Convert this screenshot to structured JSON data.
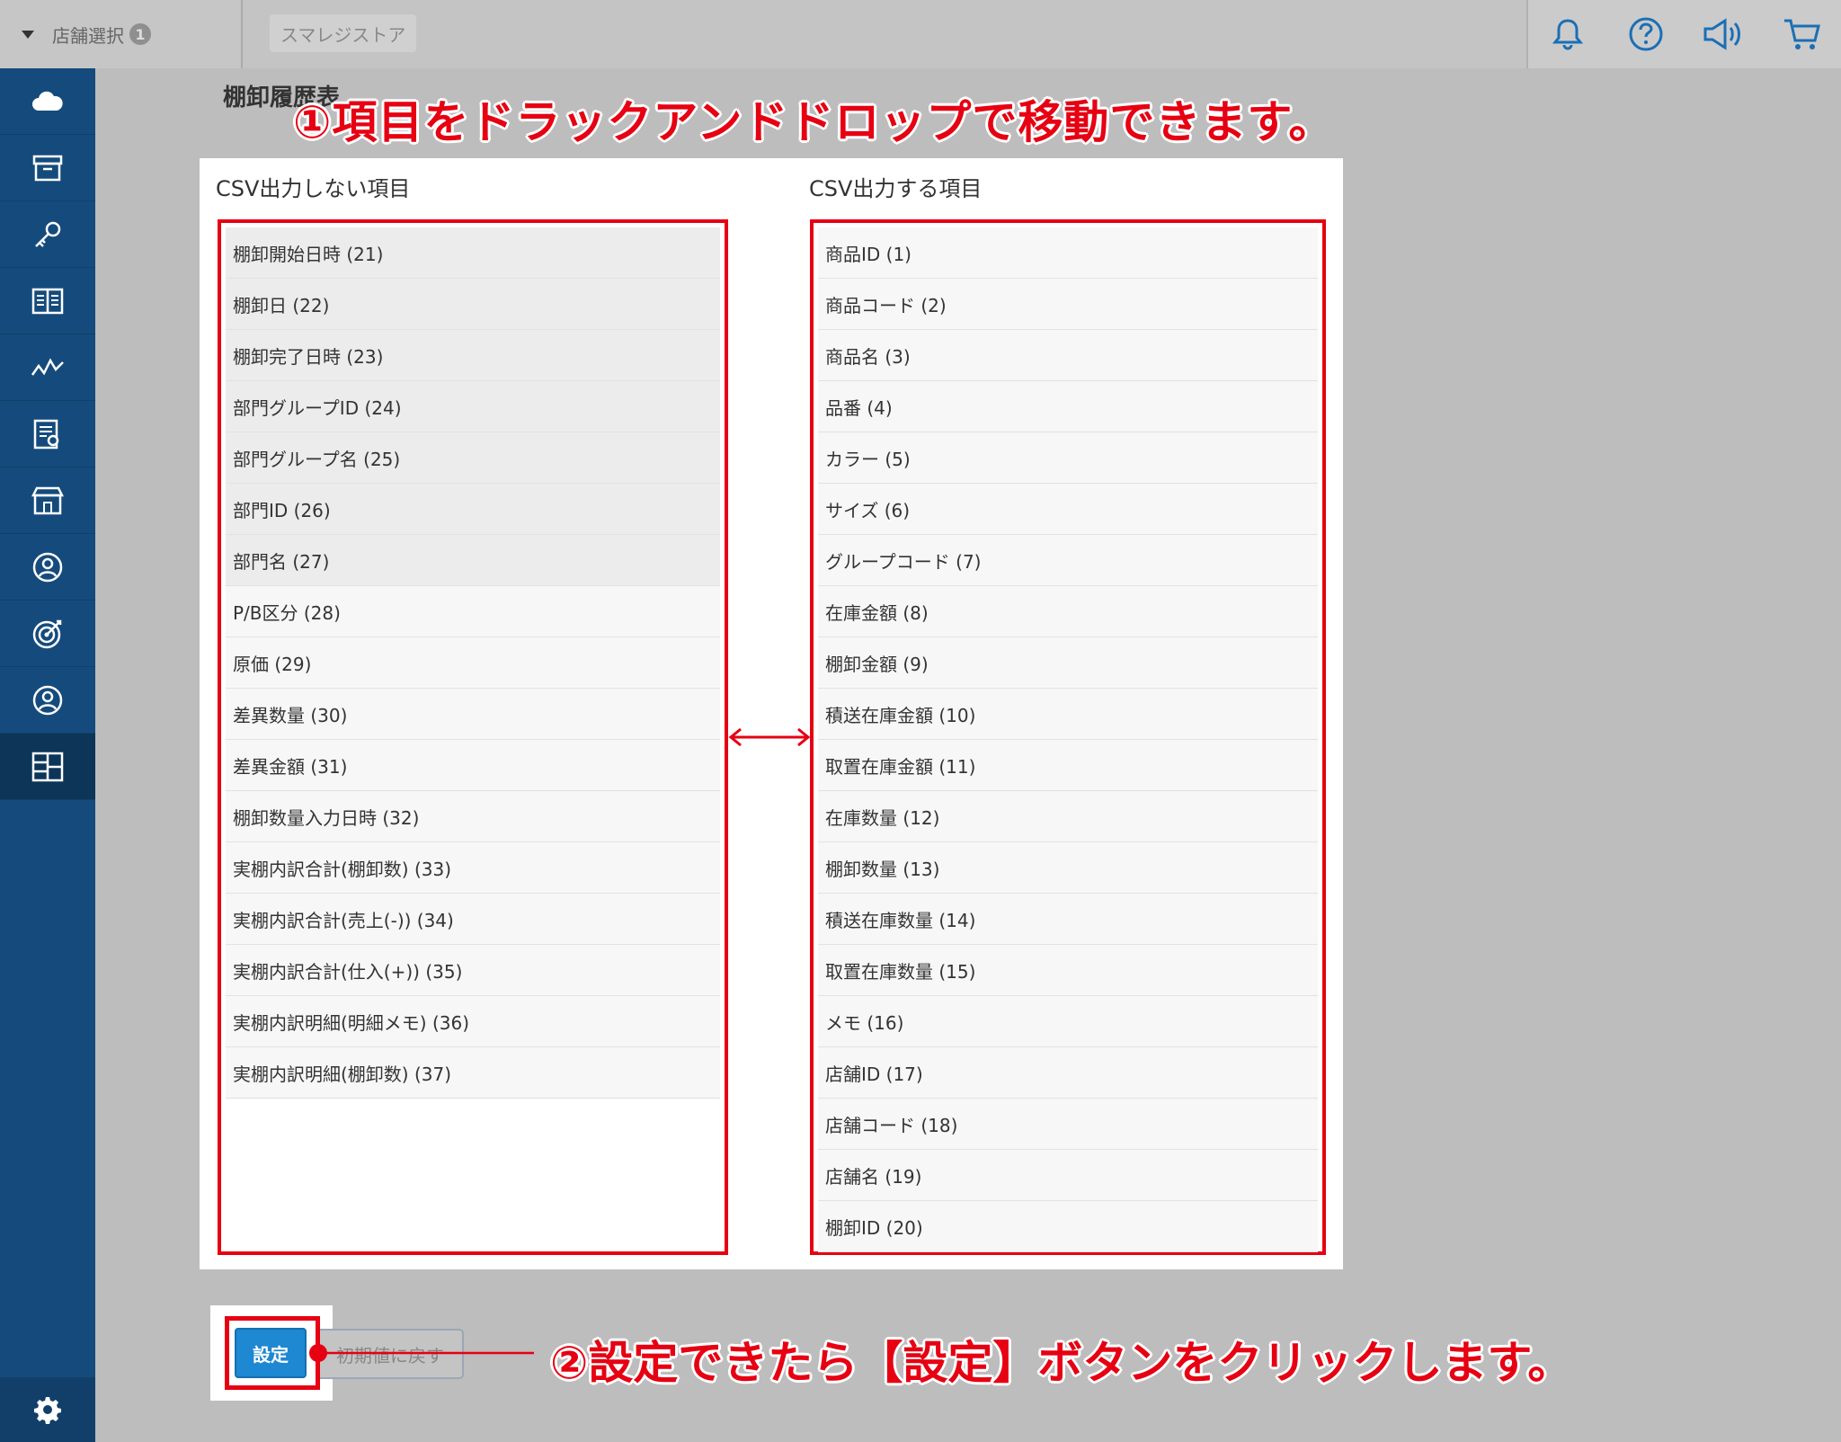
{
  "topbar": {
    "store_select_label": "店舗選択",
    "store_select_badge": "1",
    "store_name": "スマレジストア"
  },
  "page": {
    "title": "棚卸履歴表"
  },
  "annotations": {
    "step1": "①項目をドラックアンドドロップで移動できます。",
    "step2": "②設定できたら【設定】ボタンをクリックします。"
  },
  "columns": {
    "left_heading": "CSV出力しない項目",
    "right_heading": "CSV出力する項目"
  },
  "left_items": [
    "棚卸開始日時 (21)",
    "棚卸日 (22)",
    "棚卸完了日時 (23)",
    "部門グループID (24)",
    "部門グループ名 (25)",
    "部門ID (26)",
    "部門名 (27)",
    "P/B区分 (28)",
    "原価 (29)",
    "差異数量 (30)",
    "差異金額 (31)",
    "棚卸数量入力日時 (32)",
    "実棚内訳合計(棚卸数) (33)",
    "実棚内訳合計(売上(-)) (34)",
    "実棚内訳合計(仕入(+)) (35)",
    "実棚内訳明細(明細メモ) (36)",
    "実棚内訳明細(棚卸数) (37)"
  ],
  "right_items": [
    "商品ID (1)",
    "商品コード (2)",
    "商品名 (3)",
    "品番 (4)",
    "カラー (5)",
    "サイズ (6)",
    "グループコード (7)",
    "在庫金額 (8)",
    "棚卸金額 (9)",
    "積送在庫金額 (10)",
    "取置在庫金額 (11)",
    "在庫数量 (12)",
    "棚卸数量 (13)",
    "積送在庫数量 (14)",
    "取置在庫数量 (15)",
    "メモ (16)",
    "店舗ID (17)",
    "店舗コード (18)",
    "店舗名 (19)",
    "棚卸ID (20)"
  ],
  "buttons": {
    "save": "設定",
    "reset": "初期値に戻す"
  },
  "colors": {
    "accent_red": "#e60012",
    "sidebar": "#154b7c",
    "button_blue": "#1e88d2"
  }
}
